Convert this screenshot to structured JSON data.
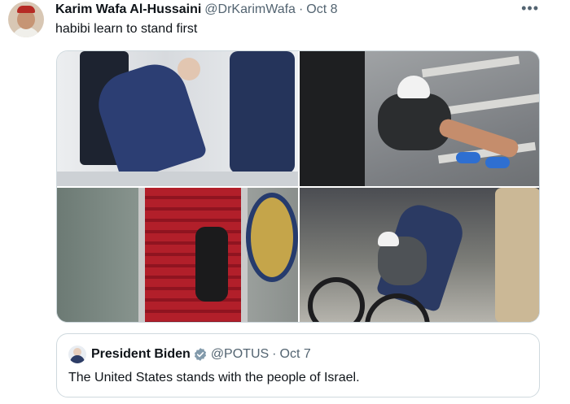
{
  "tweet": {
    "author_name": "Karim Wafa Al-Hussaini",
    "handle": "@DrKarimWafa",
    "separator": "·",
    "date": "Oct 8",
    "more_icon": "ellipsis-icon",
    "text": "habibi learn to stand first",
    "media": [
      {
        "subject": "man stumbling on stairs"
      },
      {
        "subject": "cyclist falling"
      },
      {
        "subject": "man climbing airplane stairs"
      },
      {
        "subject": "cyclist fallen with helpers"
      }
    ]
  },
  "quoted_tweet": {
    "author_name": "President Biden",
    "verified_icon": "verified-badge-icon",
    "badge_color": "#829aab",
    "handle": "@POTUS",
    "separator": "·",
    "date": "Oct 7",
    "text": "The United States stands with the people of Israel."
  }
}
